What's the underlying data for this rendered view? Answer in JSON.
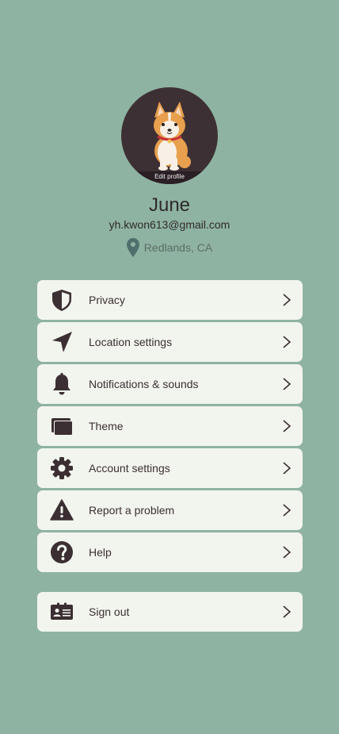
{
  "profile": {
    "edit_label": "Edit profile",
    "name": "June",
    "email": "yh.kwon613@gmail.com",
    "location": "Redlands, CA"
  },
  "menu": {
    "items": [
      {
        "label": "Privacy",
        "icon": "shield-icon"
      },
      {
        "label": "Location settings",
        "icon": "navigation-arrow-icon"
      },
      {
        "label": "Notifications & sounds",
        "icon": "bell-icon"
      },
      {
        "label": "Theme",
        "icon": "windows-icon"
      },
      {
        "label": "Account settings",
        "icon": "gear-icon"
      },
      {
        "label": "Report a problem",
        "icon": "warning-icon"
      },
      {
        "label": "Help",
        "icon": "help-icon"
      }
    ],
    "sign_out": {
      "label": "Sign out",
      "icon": "id-card-icon"
    }
  },
  "colors": {
    "background": "#8fb3a2",
    "card": "#f2f5ee",
    "icon": "#3b2f33",
    "avatar_bg": "#3d3034",
    "pin": "#4f6f6c"
  }
}
